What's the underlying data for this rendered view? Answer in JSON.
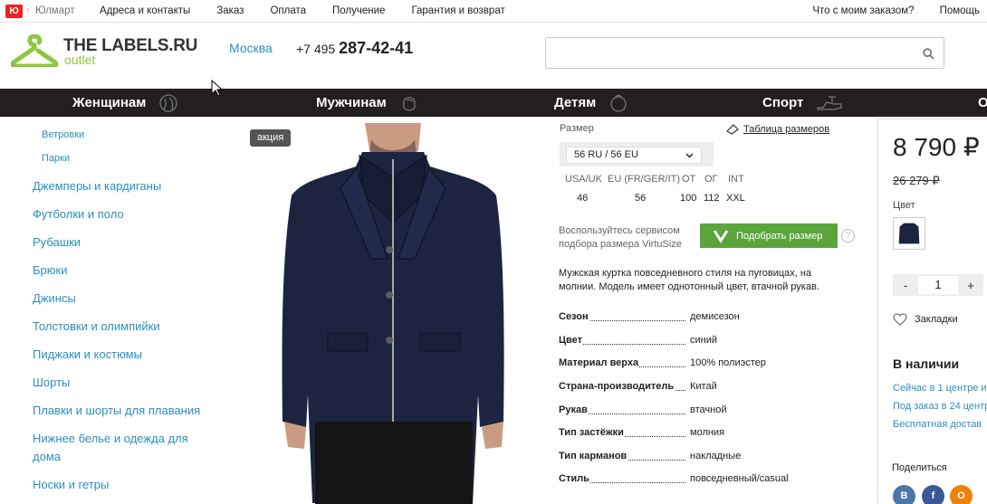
{
  "topbar": {
    "ym_logo": "Ю",
    "ym_sep": "›",
    "ym_name": "Юлмарт",
    "links": [
      "Адреса и контакты",
      "Заказ",
      "Оплата",
      "Получение",
      "Гарантия и возврат"
    ],
    "right": [
      "Что с моим заказом?",
      "Помощь"
    ]
  },
  "header": {
    "logo_text": "THE LABELS.RU",
    "logo_sub": "outlet",
    "city": "Москва",
    "phone_prefix": "+7 495",
    "phone_main": "287-42-41",
    "search_value": "",
    "search_icon": "search-icon"
  },
  "nav": [
    "Женщинам",
    "Мужчинам",
    "Детям",
    "Спорт",
    "О"
  ],
  "sidebar": {
    "subitems": [
      "Ветровки",
      "Парки"
    ],
    "categories": [
      "Джемперы и кардиганы",
      "Футболки и поло",
      "Рубашки",
      "Брюки",
      "Джинсы",
      "Толстовки и олимпийки",
      "Пиджаки и костюмы",
      "Шорты",
      "Плавки и шорты для плавания",
      "Нижнее белье и одежда для",
      "дома",
      "Носки и гетры"
    ]
  },
  "product": {
    "badge": "акция",
    "size_label": "Размер",
    "size_table_link": "Таблица размеров",
    "size_selected": "56 RU / 56 EU",
    "size_headers": [
      "USA/UK",
      "EU (FR/GER/IT)",
      "ОТ",
      "ОГ",
      "INT"
    ],
    "size_values": [
      "46",
      "56",
      "100",
      "112",
      "XXL"
    ],
    "virtusize_text_1": "Воспользуйтесь сервисом",
    "virtusize_text_2": "подбора размера VirtuSize",
    "virtusize_button": "Подобрать размер",
    "help": "?",
    "description_1": "Мужская куртка повседневного стиля на пуговицах, на",
    "description_2": "молнии. Модель имеет однотонный цвет, втачной рукав.",
    "specs": [
      {
        "k": "Сезон",
        "v": "демисезон"
      },
      {
        "k": "Цвет",
        "v": "синий"
      },
      {
        "k": "Материал верха",
        "v": "100% полиэстер"
      },
      {
        "k": "Страна-производитель",
        "v": "Китай"
      },
      {
        "k": "Рукав",
        "v": "втачной"
      },
      {
        "k": "Тип застёжки",
        "v": "молния"
      },
      {
        "k": "Тип карманов",
        "v": "накладные"
      },
      {
        "k": "Стиль",
        "v": "повседневный/casual"
      }
    ]
  },
  "panel": {
    "price": "8 790 ₽",
    "old_price": "26 279 ₽",
    "color_label": "Цвет",
    "qty_minus": "-",
    "qty_value": "1",
    "qty_plus": "+",
    "favorites": "Закладки",
    "stock_title": "В наличии",
    "stock_lines": [
      "Сейчас в 1 центре и",
      "Под заказ в 24 центр",
      "Бесплатная достав"
    ],
    "share": "Поделиться",
    "social": [
      "В",
      "f",
      "О"
    ]
  },
  "colors": {
    "nav_bg": "#231f20",
    "link": "#2a8fc4",
    "brand_green": "#8dc63f",
    "virtusize_green": "#5ba53d",
    "jacket": "#1c2440"
  }
}
